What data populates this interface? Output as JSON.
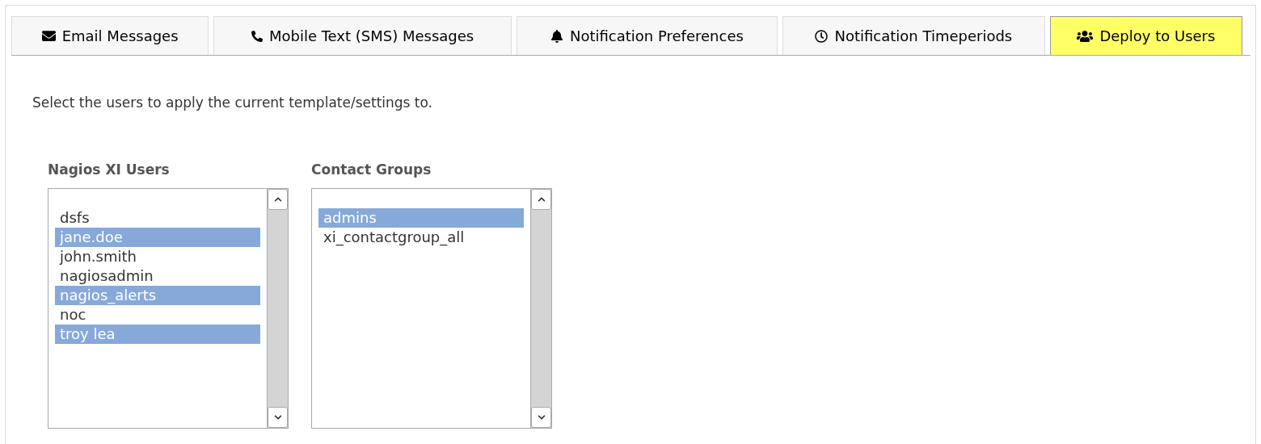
{
  "tabs": [
    {
      "label": "Email Messages",
      "selected": false
    },
    {
      "label": "Mobile Text (SMS) Messages",
      "selected": false
    },
    {
      "label": "Notification Preferences",
      "selected": false
    },
    {
      "label": "Notification Timeperiods",
      "selected": false
    },
    {
      "label": "Deploy to Users",
      "selected": true
    }
  ],
  "instructions": "Select the users to apply the current template/settings to.",
  "lists": [
    {
      "heading": "Nagios XI Users",
      "items": [
        {
          "label": "dsfs",
          "selected": false
        },
        {
          "label": "jane.doe",
          "selected": true
        },
        {
          "label": "john.smith",
          "selected": false
        },
        {
          "label": "nagiosadmin",
          "selected": false
        },
        {
          "label": "nagios_alerts",
          "selected": true
        },
        {
          "label": "noc",
          "selected": false
        },
        {
          "label": "troy lea",
          "selected": true
        }
      ]
    },
    {
      "heading": "Contact Groups",
      "items": [
        {
          "label": "admins",
          "selected": true
        },
        {
          "label": "xi_contactgroup_all",
          "selected": false
        }
      ]
    }
  ]
}
